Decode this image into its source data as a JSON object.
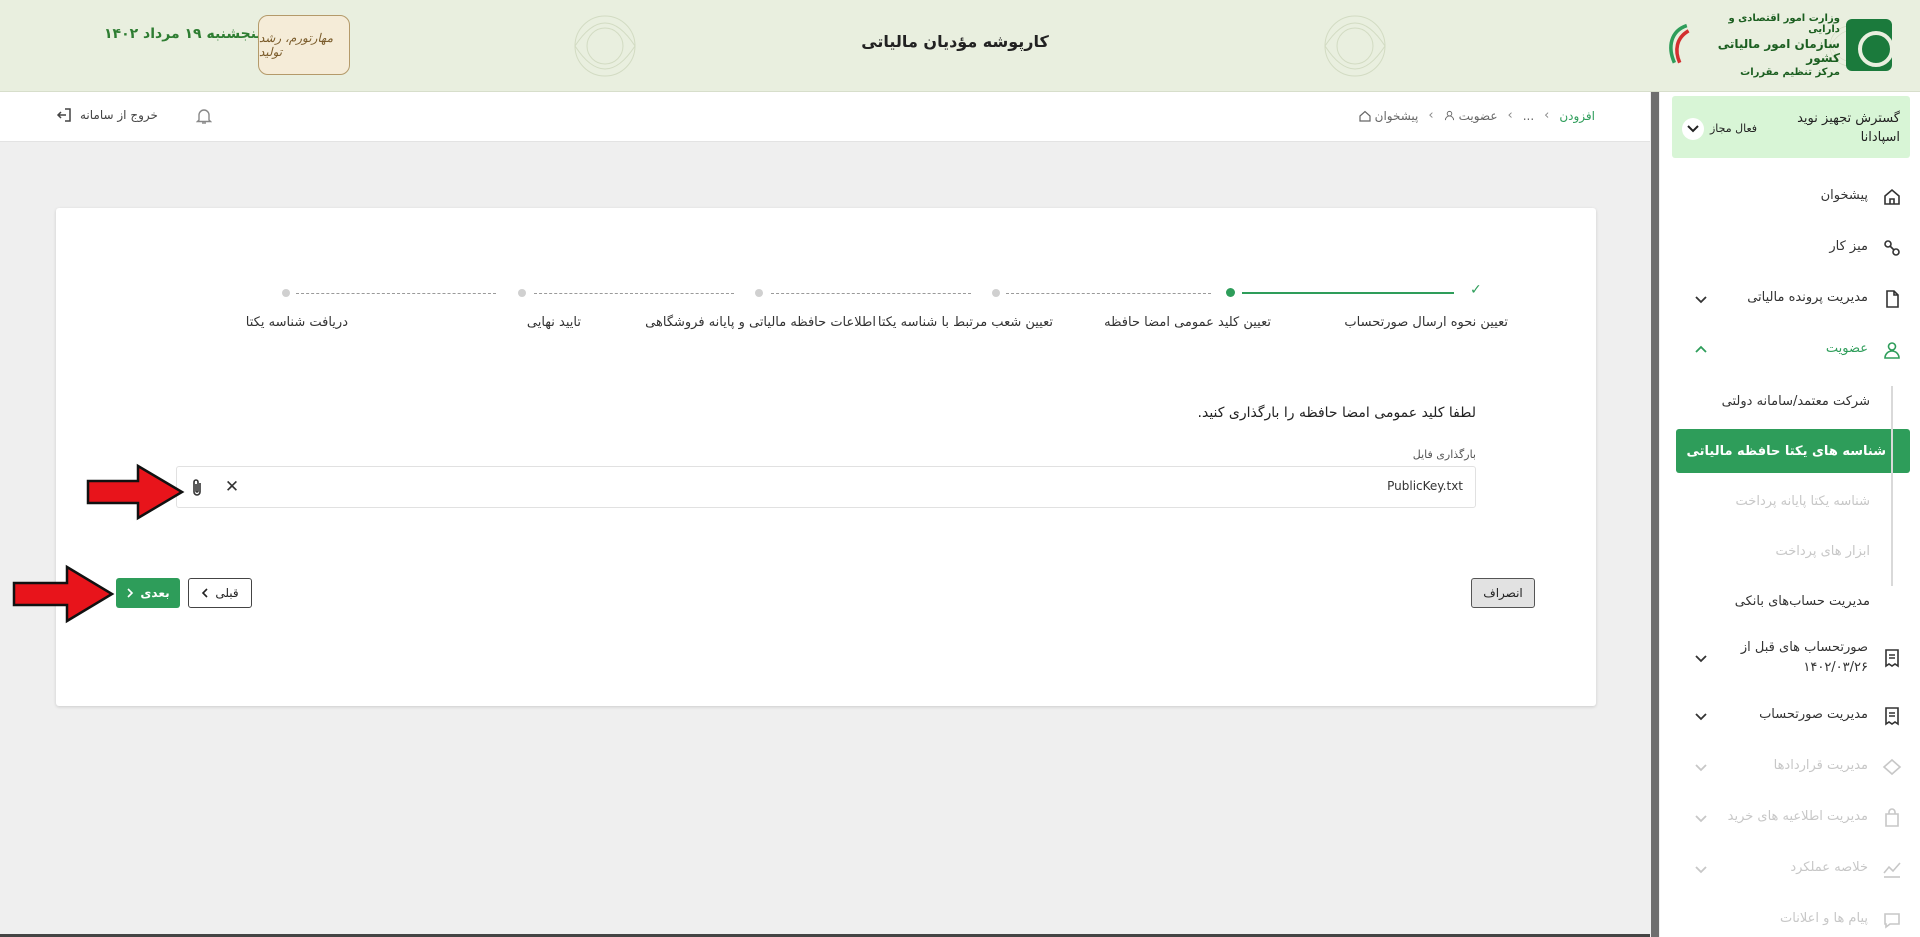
{
  "header": {
    "app_title": "کارپوشه مؤدیان مالیاتی",
    "date": "پنجشنبه ۱۹ مرداد ۱۴۰۲",
    "org_line1": "وزارت امور اقتصادی و دارایی",
    "org_line2": "سازمان امور مالیاتی کشور",
    "org_line3": "مرکز تنظیم مقررات",
    "seal_text": "مهارتورم، رشد تولید"
  },
  "subbar": {
    "logout_label": "خروج از سامانه",
    "breadcrumb": [
      "پیشخوان",
      "عضویت",
      "...",
      "افزودن"
    ]
  },
  "sidebar": {
    "company_name": "گسترش تجهیز نوید اسپادانا",
    "company_status": "فعال مجاز",
    "items": [
      {
        "label": "پیشخوان",
        "icon": "home-icon"
      },
      {
        "label": "میز کار",
        "icon": "workspace-icon"
      },
      {
        "label": "مدیریت پرونده مالیاتی",
        "icon": "file-icon"
      },
      {
        "label": "عضویت",
        "icon": "user-icon"
      }
    ],
    "subitems": [
      {
        "label": "شرکت معتمد/سامانه دولتی"
      },
      {
        "label": "شناسه های یکتا حافظه مالیاتی"
      },
      {
        "label": "شناسه یکتا پایانه پرداخت"
      },
      {
        "label": "ابزار های پرداخت"
      },
      {
        "label": "مدیریت حساب‌های بانکی"
      }
    ],
    "items2": [
      {
        "label": "صورتحساب های قبل از ۱۴۰۲/۰۳/۲۶",
        "icon": "invoice-icon"
      },
      {
        "label": "مدیریت صورتحساب",
        "icon": "invoice-icon"
      },
      {
        "label": "مدیریت قراردادها",
        "icon": "contract-icon"
      },
      {
        "label": "مدیریت اطلاعیه های خرید",
        "icon": "bag-icon"
      },
      {
        "label": "خلاصه عملکرد",
        "icon": "chart-icon"
      },
      {
        "label": "پیام ها و اعلانات",
        "icon": "message-icon"
      }
    ]
  },
  "stepper": {
    "steps": [
      "تعیین نحوه ارسال صورتحساب",
      "تعیین کلید عمومی امضا حافظه",
      "تعیین شعب مرتبط با شناسه یکتا",
      "اطلاعات حافظه مالیاتی و پایانه فروشگاهی",
      "تایید نهایی",
      "دریافت شناسه یکتا"
    ]
  },
  "form": {
    "instruction": "لطفا کلید عمومی امضا حافظه را بارگذاری کنید.",
    "field_label": "بارگذاری فایل",
    "file_name": "PublicKey.txt"
  },
  "buttons": {
    "cancel": "انصراف",
    "next": "بعدی",
    "prev": "قبلی"
  },
  "colors": {
    "accent": "#2e9d5a",
    "header_bg": "#e9efdf",
    "company_bg": "#d8f5d6",
    "annotation_arrow": "#e8141b"
  }
}
